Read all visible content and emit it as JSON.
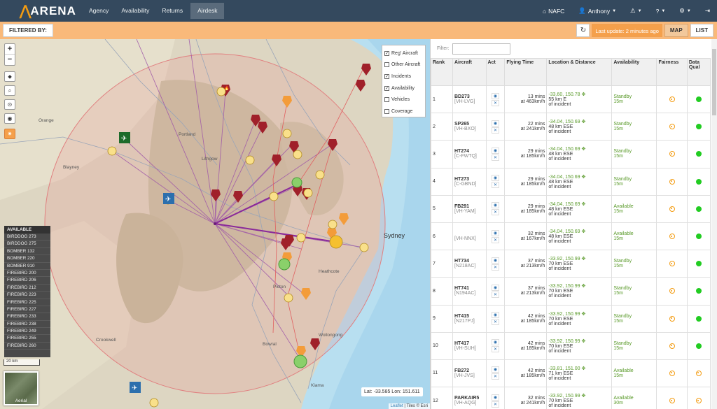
{
  "nav": {
    "brand": "ARENA",
    "links": [
      "Agency",
      "Availability",
      "Returns",
      "Airdesk"
    ],
    "nafc": "NAFC",
    "user": "Anthony"
  },
  "filterbar": {
    "filtered_label": "FILTERED BY:",
    "last_update": "Last update: 2 minutes ago",
    "map_label": "MAP",
    "list_label": "LIST"
  },
  "map": {
    "layers": [
      {
        "label": "Reg' Aircraft",
        "checked": true
      },
      {
        "label": "Other Aircraft",
        "checked": false
      },
      {
        "label": "Incidents",
        "checked": true
      },
      {
        "label": "Availability",
        "checked": true
      },
      {
        "label": "Vehicles",
        "checked": false
      },
      {
        "label": "Coverage",
        "checked": false
      }
    ],
    "available_header": "AVAILABLE",
    "available": [
      "BIRDDOG 273",
      "BIRDDOG 275",
      "BOMBER 132",
      "BOMBER 220",
      "BOMBER 910",
      "FIREBIRD 200",
      "FIREBIRD 206",
      "FIREBIRD 212",
      "FIREBIRD 223",
      "FIREBIRD 225",
      "FIREBIRD 227",
      "FIREBIRD 233",
      "FIREBIRD 238",
      "FIREBIRD 249",
      "FIREBIRD 255",
      "FIREBIRD 260"
    ],
    "scale": "20 km",
    "aerial": "Aerial",
    "latlon": "Lat: -33.585 Lon: 151.611",
    "attrib_leaflet": "Leaflet",
    "attrib_rest": "| Tiles © Esri",
    "places": {
      "sydney": "Sydney",
      "orange": "Orange",
      "blayney": "Blayney",
      "portland": "Portland",
      "lithgow": "Lithgow",
      "crookwell": "Crookwell",
      "wollongong": "Wollongong",
      "kiama": "Kiama",
      "bowral": "Bowral",
      "heathcote": "Heathcote",
      "picton": "Picton"
    }
  },
  "list": {
    "filter_label": "Filter:",
    "headers": [
      "Rank",
      "Aircraft",
      "Act",
      "Flying Time",
      "Location & Distance",
      "Availability",
      "Fairness",
      "Data Qual"
    ],
    "rows": [
      {
        "rank": "1",
        "name": "BD273",
        "reg": "[VH-LVG]",
        "time": "13 mins",
        "speed": "at 463km/h",
        "ll": "-33.60, 150.78 ✥",
        "dist": "55 km E",
        "of": "of incident",
        "status": "Standby",
        "mins": "15m",
        "dq": "green"
      },
      {
        "rank": "2",
        "name": "SP265",
        "reg": "[VH-BXO]",
        "time": "22 mins",
        "speed": "at 241km/h",
        "ll": "-34.04, 150.69 ✥",
        "dist": "48 km ESE",
        "of": "of incident",
        "status": "Standby",
        "mins": "15m",
        "dq": "green"
      },
      {
        "rank": "3",
        "name": "HT274",
        "reg": "[C-FWTQ]",
        "time": "29 mins",
        "speed": "at 185km/h",
        "ll": "-34.04, 150.69 ✥",
        "dist": "48 km ESE",
        "of": "of incident",
        "status": "Standby",
        "mins": "15m",
        "dq": "green"
      },
      {
        "rank": "4",
        "name": "HT273",
        "reg": "[C-GBND]",
        "time": "29 mins",
        "speed": "at 185km/h",
        "ll": "-34.04, 150.69 ✥",
        "dist": "48 km ESE",
        "of": "of incident",
        "status": "Standby",
        "mins": "15m",
        "dq": "green"
      },
      {
        "rank": "5",
        "name": "FB291",
        "reg": "[VH-YAM]",
        "time": "29 mins",
        "speed": "at 185km/h",
        "ll": "-34.04, 150.69 ✥",
        "dist": "48 km ESE",
        "of": "of incident",
        "status": "Available",
        "mins": "15m",
        "dq": "green"
      },
      {
        "rank": "6",
        "name": "",
        "reg": "[VH-NNX]",
        "time": "32 mins",
        "speed": "at 167km/h",
        "ll": "-34.04, 150.69 ✥",
        "dist": "48 km ESE",
        "of": "of incident",
        "status": "Available",
        "mins": "15m",
        "dq": "green"
      },
      {
        "rank": "7",
        "name": "HT734",
        "reg": "[N218AC]",
        "time": "37 mins",
        "speed": "at 213km/h",
        "ll": "-33.92, 150.99 ✥",
        "dist": "70 km ESE",
        "of": "of incident",
        "status": "Standby",
        "mins": "15m",
        "dq": "green"
      },
      {
        "rank": "8",
        "name": "HT741",
        "reg": "[N194AC]",
        "time": "37 mins",
        "speed": "at 213km/h",
        "ll": "-33.92, 150.99 ✥",
        "dist": "70 km ESE",
        "of": "of incident",
        "status": "Standby",
        "mins": "15m",
        "dq": "green"
      },
      {
        "rank": "9",
        "name": "HT415",
        "reg": "[N217PJ]",
        "time": "42 mins",
        "speed": "at 185km/h",
        "ll": "-33.92, 150.99 ✥",
        "dist": "70 km ESE",
        "of": "of incident",
        "status": "Standby",
        "mins": "15m",
        "dq": "green"
      },
      {
        "rank": "10",
        "name": "HT417",
        "reg": "[VH-SUH]",
        "time": "42 mins",
        "speed": "at 185km/h",
        "ll": "-33.92, 150.99 ✥",
        "dist": "70 km ESE",
        "of": "of incident",
        "status": "Standby",
        "mins": "15m",
        "dq": "green"
      },
      {
        "rank": "11",
        "name": "FB272",
        "reg": "[VH-JVS]",
        "time": "42 mins",
        "speed": "at 185km/h",
        "ll": "-33.81, 151.00 ✥",
        "dist": "71 km ESE",
        "of": "of incident",
        "status": "Available",
        "mins": "15m",
        "dq": "orange"
      },
      {
        "rank": "12",
        "name": "PARKAIR5",
        "reg": "[VH-AQG]",
        "time": "32 mins",
        "speed": "at 241km/h",
        "ll": "-33.92, 150.99 ✥",
        "dist": "70 km ESE",
        "of": "of incident",
        "status": "Available",
        "mins": "30m",
        "dq": "orange"
      }
    ]
  }
}
